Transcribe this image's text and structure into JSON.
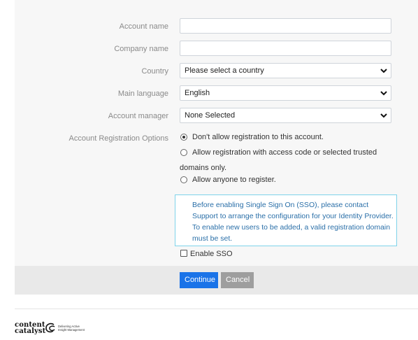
{
  "form": {
    "account_name": {
      "label": "Account name",
      "value": ""
    },
    "company_name": {
      "label": "Company name",
      "value": ""
    },
    "country": {
      "label": "Country",
      "selected": "Please select a country"
    },
    "main_language": {
      "label": "Main language",
      "selected": "English"
    },
    "account_manager": {
      "label": "Account manager",
      "selected": "None Selected"
    },
    "registration": {
      "label": "Account Registration Options",
      "options": [
        {
          "text": "Don't allow registration to this account.",
          "checked": true
        },
        {
          "text": "Allow registration with access code or selected trusted",
          "text_cont": "domains only.",
          "checked": false
        },
        {
          "text": "Allow anyone to register.",
          "checked": false
        }
      ]
    },
    "sso_info": {
      "lines": [
        "Before enabling Single Sign On (SSO), please contact",
        "Support to arrange the configuration for your Identity Provider.",
        "To enable new users to be added, a valid registration domain",
        "must be set."
      ]
    },
    "enable_sso": {
      "label": "Enable SSO",
      "checked": false
    }
  },
  "actions": {
    "continue_label": "Continue",
    "cancel_label": "Cancel"
  },
  "footer": {
    "logo_line1": "content",
    "logo_line2": "catalyst",
    "tagline_line1": "Delivering Active",
    "tagline_line2": "Insight Management"
  },
  "colors": {
    "primary": "#1a73e8",
    "secondary": "#9e9e9e",
    "info_border": "#7fd3ea",
    "info_text": "#2a6fa8"
  },
  "icons": {
    "dropdown": "chevron-down-icon",
    "logo": "content-catalyst-logo-icon"
  }
}
